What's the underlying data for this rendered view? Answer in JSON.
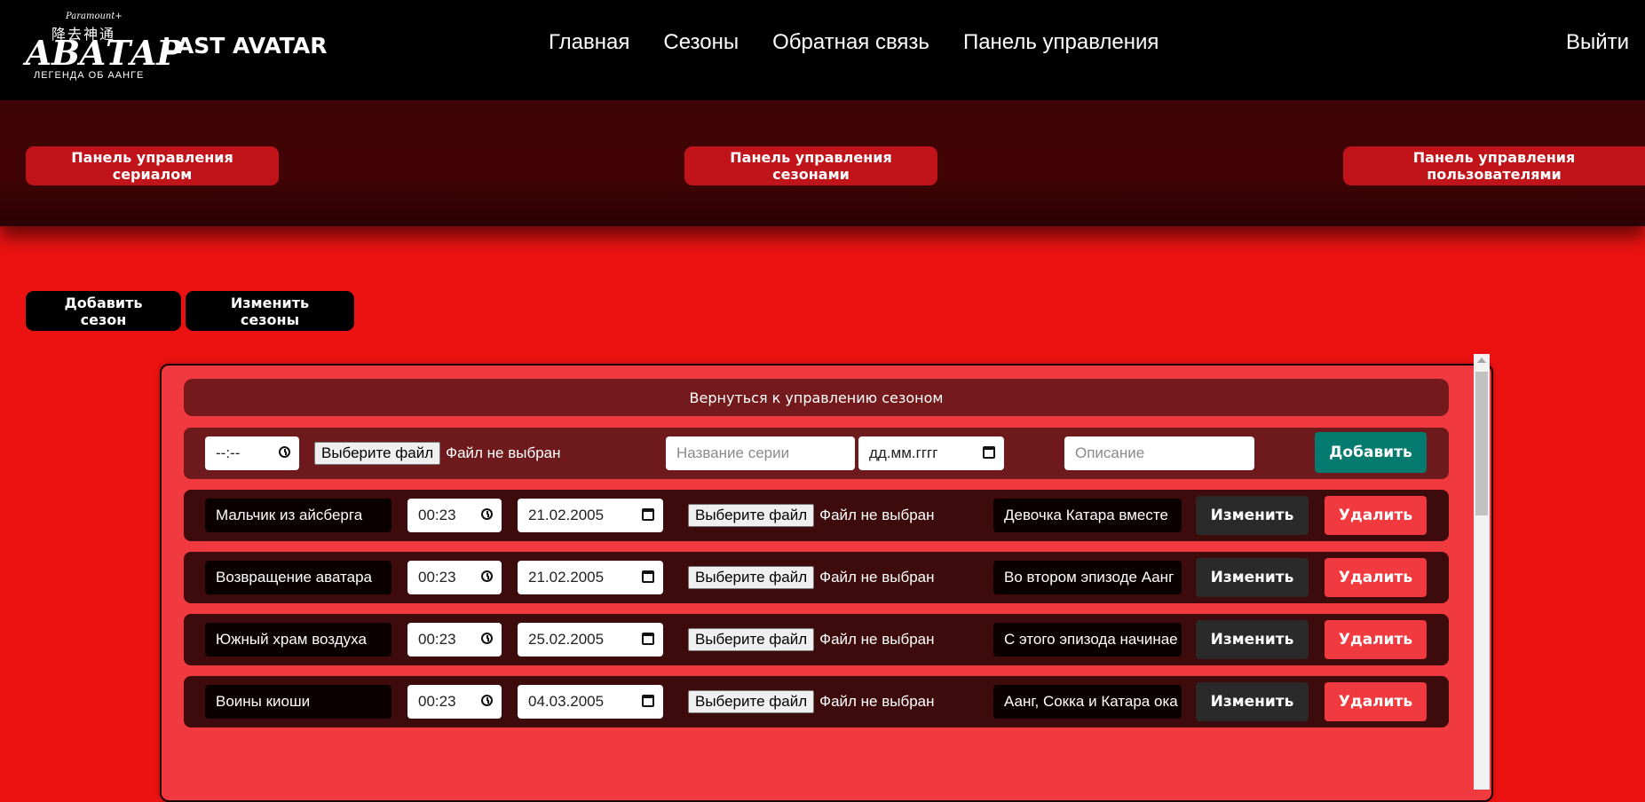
{
  "header": {
    "logo": {
      "studio": "Paramount+",
      "glyphs": "降去神通",
      "word": "АВАТАР",
      "sub": "ЛЕГЕНДА ОБ ААНГЕ"
    },
    "site_title": "LAST AVATAR",
    "nav": [
      "Главная",
      "Сезоны",
      "Обратная связь",
      "Панель управления"
    ],
    "logout": "Выйти"
  },
  "admin_panel": {
    "series_button": "Панель управления сериалом",
    "seasons_button": "Панель управления сезонами",
    "users_button": "Панель управления пользователями"
  },
  "season_actions": {
    "add_season": "Добавить сезон",
    "edit_seasons": "Изменить сезоны"
  },
  "back_bar": "Вернуться к управлению сезоном",
  "add_form": {
    "time_value": "--:--",
    "file_button": "Выберите файл",
    "file_status": "Файл не выбран",
    "title_placeholder": "Название серии",
    "date_placeholder": "дд.мм.гггг",
    "description_placeholder": "Описание",
    "add_button": "Добавить"
  },
  "episodes": [
    {
      "title": "Мальчик из айсберга",
      "duration": "00:23",
      "date": "21.02.2005",
      "file_button": "Выберите файл",
      "file_status": "Файл не выбран",
      "description": "Девочка Катара вместе",
      "edit": "Изменить",
      "delete": "Удалить"
    },
    {
      "title": "Возвращение аватара",
      "duration": "00:23",
      "date": "21.02.2005",
      "file_button": "Выберите файл",
      "file_status": "Файл не выбран",
      "description": "Во втором эпизоде Аанг",
      "edit": "Изменить",
      "delete": "Удалить"
    },
    {
      "title": "Южный храм воздуха",
      "duration": "00:23",
      "date": "25.02.2005",
      "file_button": "Выберите файл",
      "file_status": "Файл не выбран",
      "description": "С этого эпизода начинае",
      "edit": "Изменить",
      "delete": "Удалить"
    },
    {
      "title": "Воины киоши",
      "duration": "00:23",
      "date": "04.03.2005",
      "file_button": "Выберите файл",
      "file_status": "Файл не выбран",
      "description": "Аанг, Сокка и Катара ока",
      "edit": "Изменить",
      "delete": "Удалить"
    }
  ],
  "colors": {
    "page_bg": "#ec1212",
    "accent_red": "#c0141a",
    "add_green": "#047b6e"
  },
  "icons": [
    "clock-icon",
    "calendar-icon",
    "scroll-up-icon"
  ]
}
